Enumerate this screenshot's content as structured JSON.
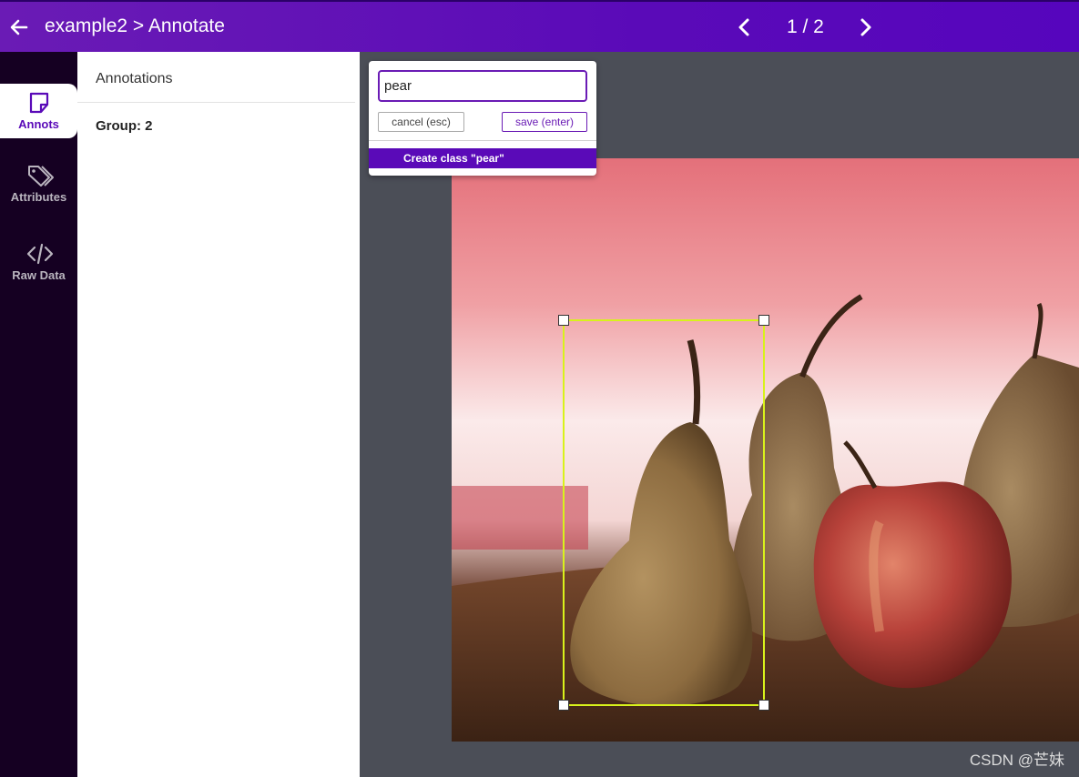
{
  "header": {
    "title": "example2 > Annotate",
    "page_indicator": "1 / 2"
  },
  "nav": {
    "items": [
      {
        "label": "Annots",
        "icon": "sticky-note-icon",
        "active": true
      },
      {
        "label": "Attributes",
        "icon": "tags-icon",
        "active": false
      },
      {
        "label": "Raw Data",
        "icon": "code-icon",
        "active": false
      }
    ]
  },
  "panel": {
    "heading": "Annotations",
    "group": "Group: 2"
  },
  "popup": {
    "input_value": "pear",
    "cancel_label": "cancel (esc)",
    "save_label": "save (enter)",
    "create_label": "Create class \"pear\""
  },
  "watermark": "CSDN @芒妹",
  "colors": {
    "accent": "#5a0ab8",
    "nav_bg": "#150022",
    "bbox": "#d8f21b",
    "canvas_bg": "#4b4e57"
  }
}
